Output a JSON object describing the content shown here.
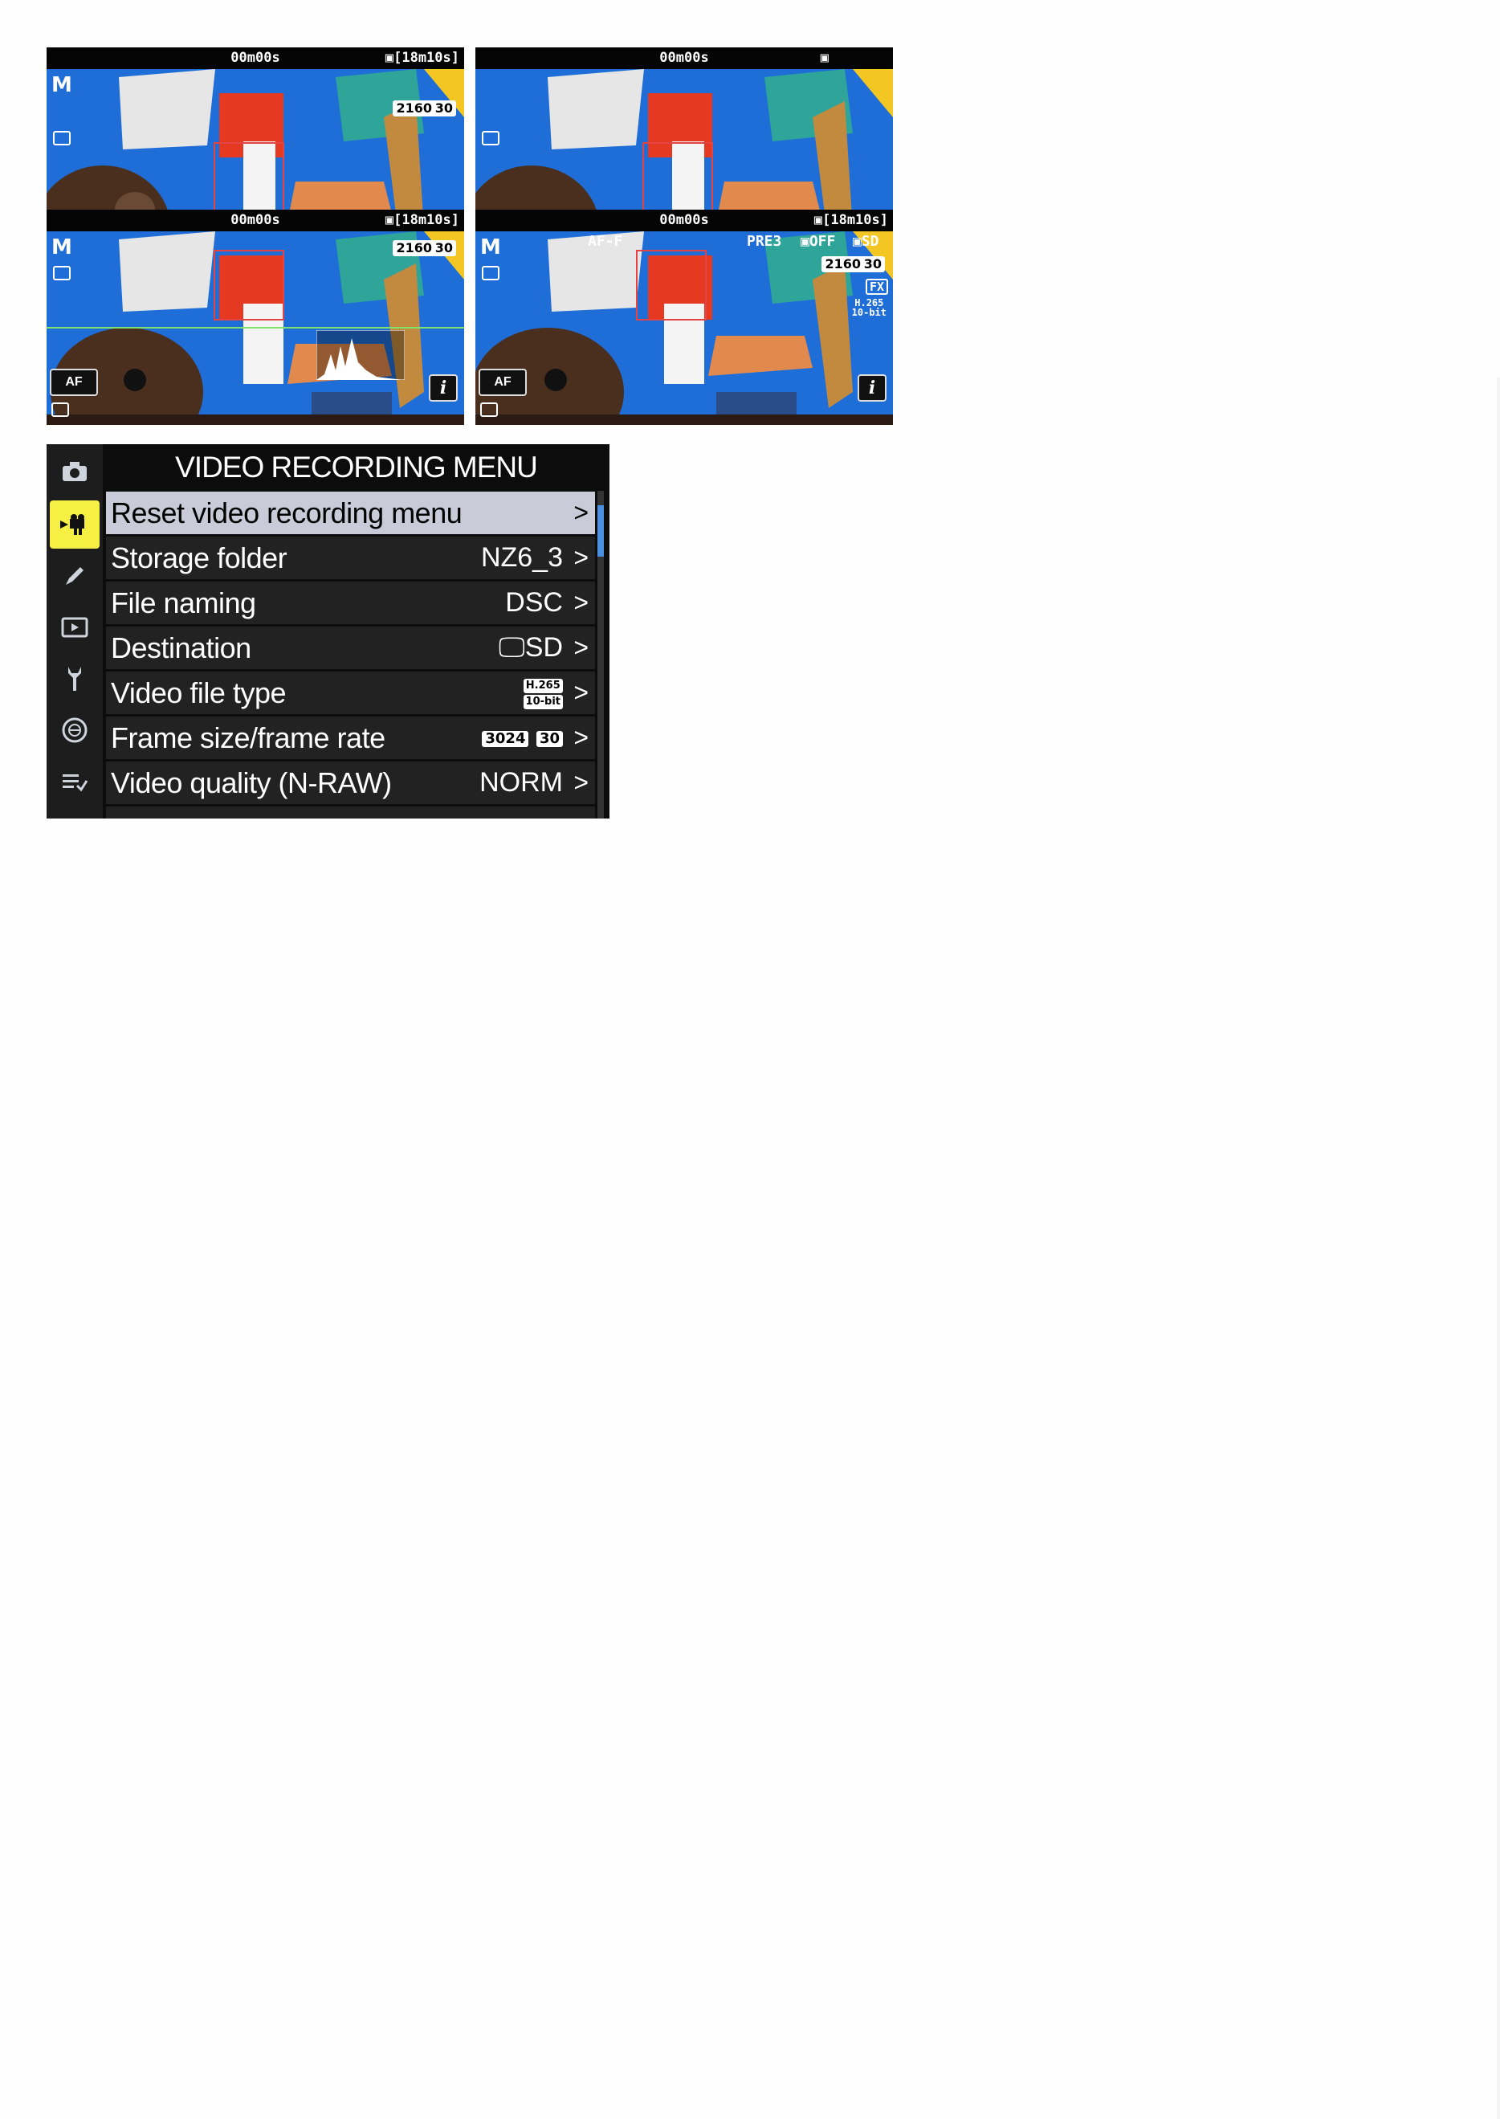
{
  "panels": [
    {
      "time": "00m00s",
      "remaining": "[18m10s]",
      "mode": "M",
      "format": "2160",
      "rate": "30"
    },
    {
      "time": "00m00s",
      "remaining": ""
    },
    {
      "time": "00m00s",
      "remaining": "[18m10s]",
      "mode": "M",
      "format": "2160",
      "rate": "30",
      "af": "AF",
      "info": "i"
    },
    {
      "time": "00m00s",
      "remaining": "[18m10s]",
      "mode": "M",
      "af_mode": "AF-F",
      "picture_control": "PRE3",
      "vr": "OFF",
      "card": "SD",
      "format": "2160",
      "rate": "30",
      "area": "FX",
      "codec": "H.265",
      "bit": "10-bit",
      "af": "AF",
      "info": "i"
    }
  ],
  "menu": {
    "title": "VIDEO RECORDING MENU",
    "side_icons": [
      "camera-icon",
      "video-camera-icon",
      "pencil-icon",
      "playback-icon",
      "wrench-icon",
      "network-icon",
      "my-menu-icon"
    ],
    "active_icon": "video-camera-icon",
    "accent": "#f6ef44",
    "items": [
      {
        "label": "Reset video recording menu",
        "value": "",
        "selected": true
      },
      {
        "label": "Storage folder",
        "value": "NZ6_3"
      },
      {
        "label": "File naming",
        "value": "DSC"
      },
      {
        "label": "Destination",
        "value": "SD"
      },
      {
        "label": "Video file type",
        "value": "",
        "badge_top": "H.265",
        "badge_bottom": "10-bit"
      },
      {
        "label": "Frame size/frame rate",
        "value": "",
        "badge_top": "3024",
        "badge_bottom": "30"
      },
      {
        "label": "Video quality (N-RAW)",
        "value": "NORM"
      }
    ],
    "chevron": ">"
  }
}
